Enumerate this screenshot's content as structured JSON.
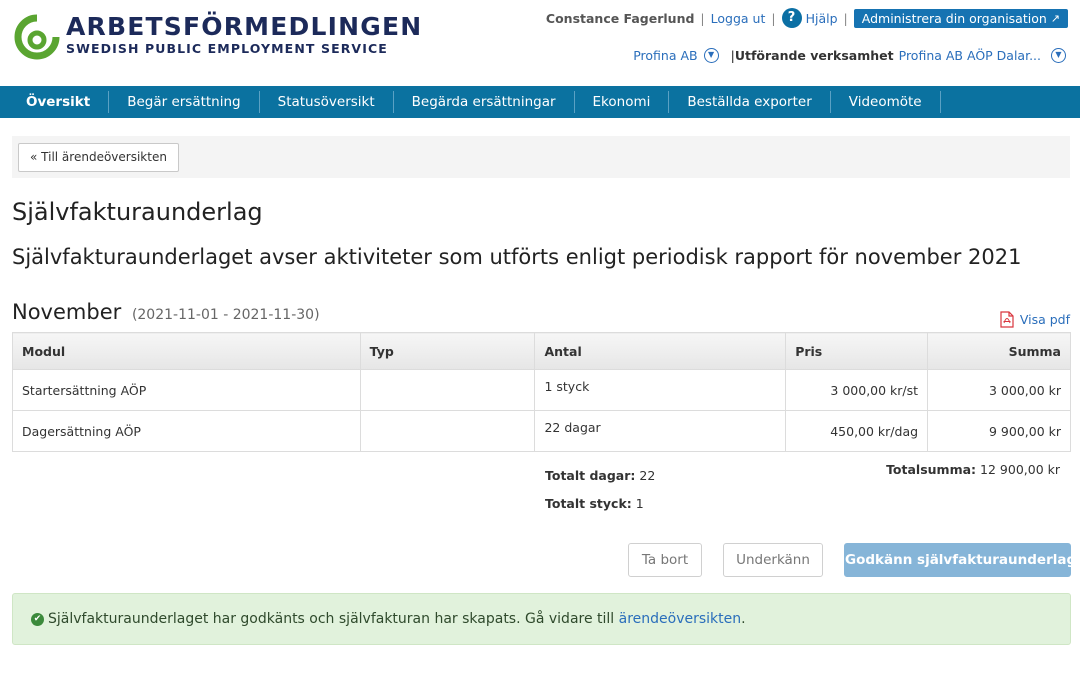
{
  "header": {
    "logo_title": "ARBETSFÖRMEDLINGEN",
    "logo_subtitle": "SWEDISH PUBLIC EMPLOYMENT SERVICE",
    "user_name": "Constance Fagerlund",
    "logout": "Logga ut",
    "help": "Hjälp",
    "admin": "Administrera din organisation",
    "org": "Profina AB",
    "unit_label": "Utförande verksamhet",
    "unit_value": "Profina AB AÖP Dalar...",
    "colors": {
      "brand_green": "#5aa531",
      "brand_navy": "#1c2a5a",
      "nav_bg": "#0b72a0"
    }
  },
  "nav": {
    "items": [
      "Översikt",
      "Begär ersättning",
      "Statusöversikt",
      "Begärda ersättningar",
      "Ekonomi",
      "Beställda exporter",
      "Videomöte"
    ]
  },
  "breadcrumb": {
    "back": "« Till ärendeöversikten"
  },
  "page": {
    "title": "Självfakturaunderlag",
    "subtitle": "Självfakturaunderlaget avser aktiviteter som utförts enligt periodisk rapport för november 2021",
    "period_name": "November",
    "period_range": "(2021-11-01 - 2021-11-30)",
    "pdf_link": "Visa pdf"
  },
  "table": {
    "headers": {
      "modul": "Modul",
      "typ": "Typ",
      "antal": "Antal",
      "pris": "Pris",
      "summa": "Summa"
    },
    "rows": [
      {
        "modul": "Startersättning AÖP",
        "typ": "",
        "antal": "1 styck",
        "pris": "3 000,00 kr/st",
        "summa": "3 000,00 kr"
      },
      {
        "modul": "Dagersättning AÖP",
        "typ": "",
        "antal": "22 dagar",
        "pris": "450,00 kr/dag",
        "summa": "9 900,00 kr"
      }
    ]
  },
  "totals": {
    "days_label": "Totalt dagar:",
    "days_value": "22",
    "pieces_label": "Totalt styck:",
    "pieces_value": "1",
    "sum_label": "Totalsumma:",
    "sum_value": "12 900,00 kr"
  },
  "actions": {
    "remove": "Ta bort",
    "reject": "Underkänn",
    "approve": "Godkänn självfakturaunderlag"
  },
  "alert": {
    "text": "Självfakturaunderlaget har godkänts och självfakturan har skapats. Gå vidare till",
    "link": "ärendeöversikten",
    "suffix": "."
  }
}
